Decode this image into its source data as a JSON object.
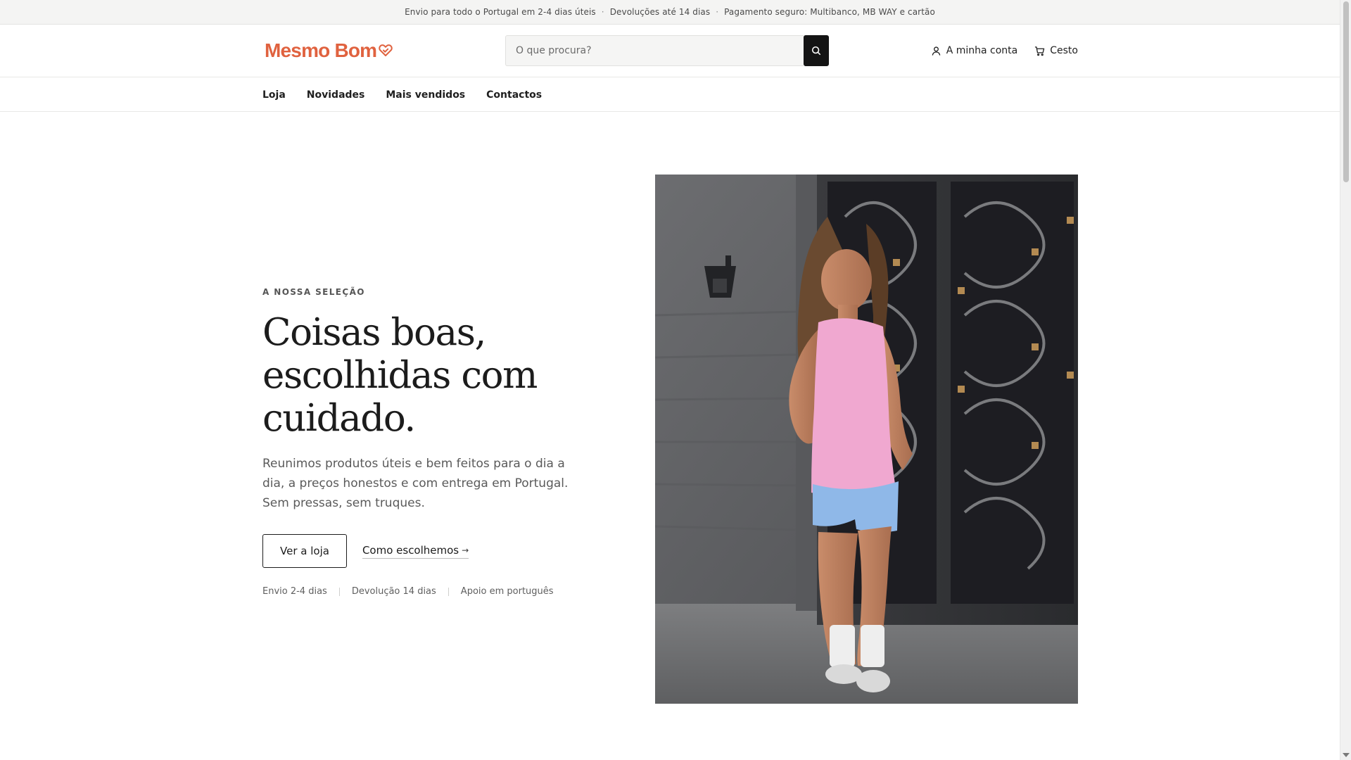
{
  "announcement": {
    "items": [
      "Envio para todo o Portugal em 2-4 dias úteis",
      "Devoluções até 14 dias",
      "Pagamento seguro: Multibanco, MB WAY e cartão"
    ],
    "separator": "·"
  },
  "header": {
    "logo_text": "Mesmo Bom",
    "logo_icon": "heart-tag-icon",
    "search": {
      "placeholder": "O que procura?",
      "value": "",
      "button_icon": "search-icon"
    },
    "account_label": "A minha conta",
    "account_icon": "user-icon",
    "cart_label": "Cesto",
    "cart_icon": "cart-icon"
  },
  "nav": {
    "items": [
      "Loja",
      "Novidades",
      "Mais vendidos",
      "Contactos"
    ]
  },
  "hero": {
    "eyebrow": "A NOSSA SELEÇÃO",
    "headline": "Coisas boas, escolhidas com cuidado.",
    "lede": "Reunimos produtos úteis e bem feitos para o dia a dia, a preços honestos e com entrega em Portugal. Sem pressas, sem truques.",
    "primary_cta": "Ver a loja",
    "secondary_cta": "Como escolhemos",
    "secondary_cta_arrow": "→",
    "trust": [
      "Envio 2-4 dias",
      "Devolução 14 dias",
      "Apoio em português"
    ]
  },
  "colors": {
    "brand": "#e0623f",
    "text": "#1f1f1f",
    "muted": "#5a5a5a",
    "announcement_bg": "#f4f4f3",
    "search_button": "#141414"
  }
}
